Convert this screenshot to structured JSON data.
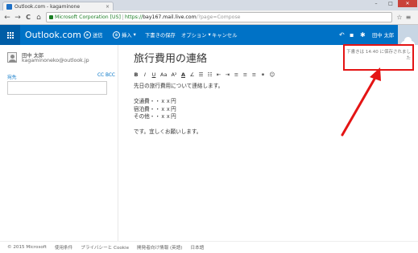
{
  "browser": {
    "tab_title": "Outlook.com - kagaminone",
    "tab_close": "×",
    "omnibox": {
      "ssl_org": "Microsoft Corporation [US]",
      "scheme": "https://",
      "host": "bay167.mail.live.com",
      "path": "/?page=Compose"
    },
    "nav_glyphs": {
      "back": "←",
      "forward": "→",
      "reload": "C",
      "home": "⌂"
    },
    "win_glyphs": {
      "min": "–",
      "max": "□",
      "close": "✕"
    }
  },
  "app_header": {
    "brand": "Outlook.com",
    "send_label": "送信",
    "insert_label": "挿入",
    "save_draft_label": "下書きの保存",
    "options_label": "オプション",
    "cancel_label": "キャンセル",
    "user_name": "田中 太郎",
    "colors": {
      "bar": "#0072c6",
      "waffle": "#005da6"
    }
  },
  "left_pane": {
    "from_name": "田中 太郎",
    "from_email": "kagaminoneko@outlook.jp",
    "to_label": "宛先",
    "cc_bcc_label": "CC BCC"
  },
  "compose": {
    "subject": "旅行費用の連絡",
    "status": "下書きは 14:40 に保存されました",
    "toolbar": [
      "B",
      "I",
      "U",
      "Aa",
      "A²",
      "A",
      "∠",
      "☰",
      "☷",
      "⇤",
      "⇥",
      "≡",
      "≡",
      "≡",
      "⚭",
      "☺"
    ],
    "body_lines": [
      "先日の旅行費用について連絡します。",
      "",
      "交通費・・ｘｘ円",
      "宿泊費・・ｘｘ円",
      "その他・・ｘｘ円",
      "",
      "です。宜しくお願いします。"
    ],
    "highlight_color": "#e41414"
  },
  "footer": {
    "links": [
      "© 2015 Microsoft",
      "使用条件",
      "プライバシーと Cookie",
      "開発者向け情報 (英語)",
      "日本語"
    ]
  }
}
